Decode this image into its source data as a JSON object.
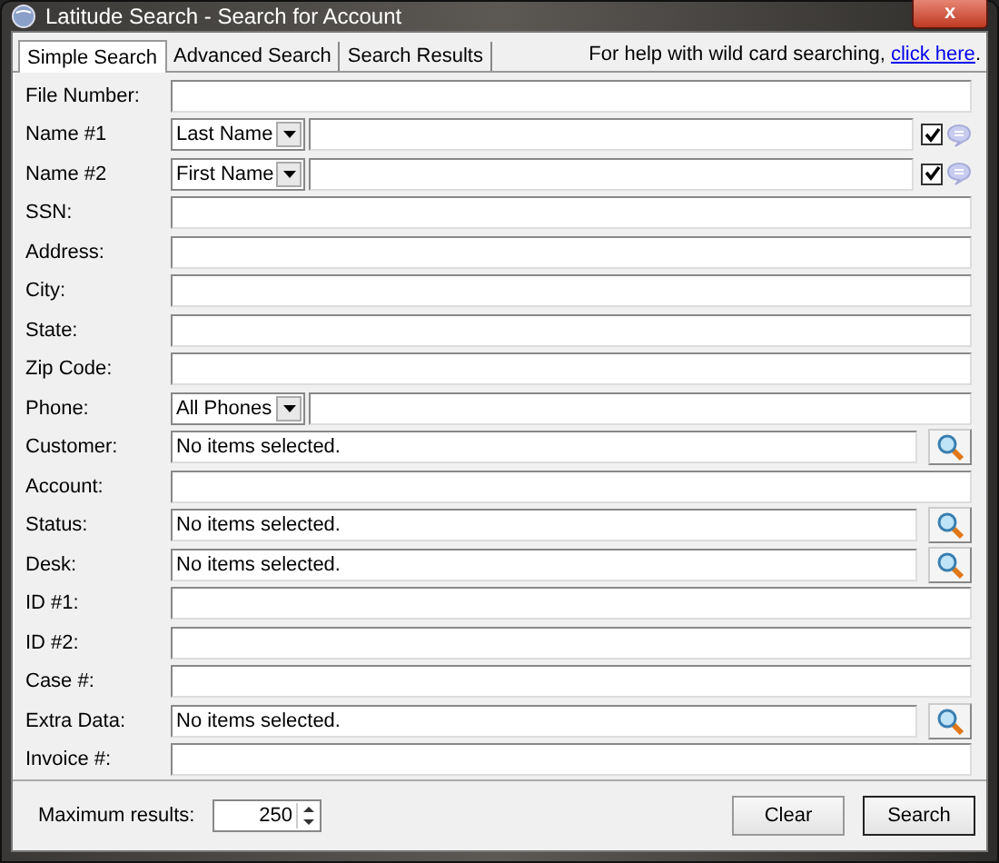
{
  "window": {
    "title": "Latitude Search - Search for Account",
    "close": "x"
  },
  "tabs": [
    {
      "label": "Simple Search",
      "selected": true
    },
    {
      "label": "Advanced Search",
      "selected": false
    },
    {
      "label": "Search Results",
      "selected": false
    }
  ],
  "help": {
    "text": "For help with wild card searching, ",
    "link": "click here",
    "after": "."
  },
  "fields": [
    {
      "kind": "text",
      "label": "File Number:"
    },
    {
      "kind": "name",
      "label": "Name #1",
      "option": "Last Name",
      "checked": true
    },
    {
      "kind": "name",
      "label": "Name #2",
      "option": "First Name",
      "checked": true
    },
    {
      "kind": "text",
      "label": "SSN:"
    },
    {
      "kind": "text",
      "label": "Address:"
    },
    {
      "kind": "text",
      "label": "City:"
    },
    {
      "kind": "text",
      "label": "State:"
    },
    {
      "kind": "text",
      "label": "Zip Code:"
    },
    {
      "kind": "dropdown",
      "label": "Phone:",
      "option": "All Phones"
    },
    {
      "kind": "picker",
      "label": "Customer:",
      "value": "No items selected."
    },
    {
      "kind": "text",
      "label": "Account:"
    },
    {
      "kind": "picker",
      "label": "Status:",
      "value": "No items selected."
    },
    {
      "kind": "picker",
      "label": "Desk:",
      "value": "No items selected."
    },
    {
      "kind": "text",
      "label": "ID #1:"
    },
    {
      "kind": "text",
      "label": "ID #2:"
    },
    {
      "kind": "text",
      "label": "Case #:"
    },
    {
      "kind": "picker",
      "label": "Extra Data:",
      "value": "No items selected."
    },
    {
      "kind": "text",
      "label": "Invoice #:"
    }
  ],
  "footer": {
    "max_label": "Maximum results:",
    "max_value": "250",
    "buttons": [
      "Clear",
      "Search"
    ]
  }
}
